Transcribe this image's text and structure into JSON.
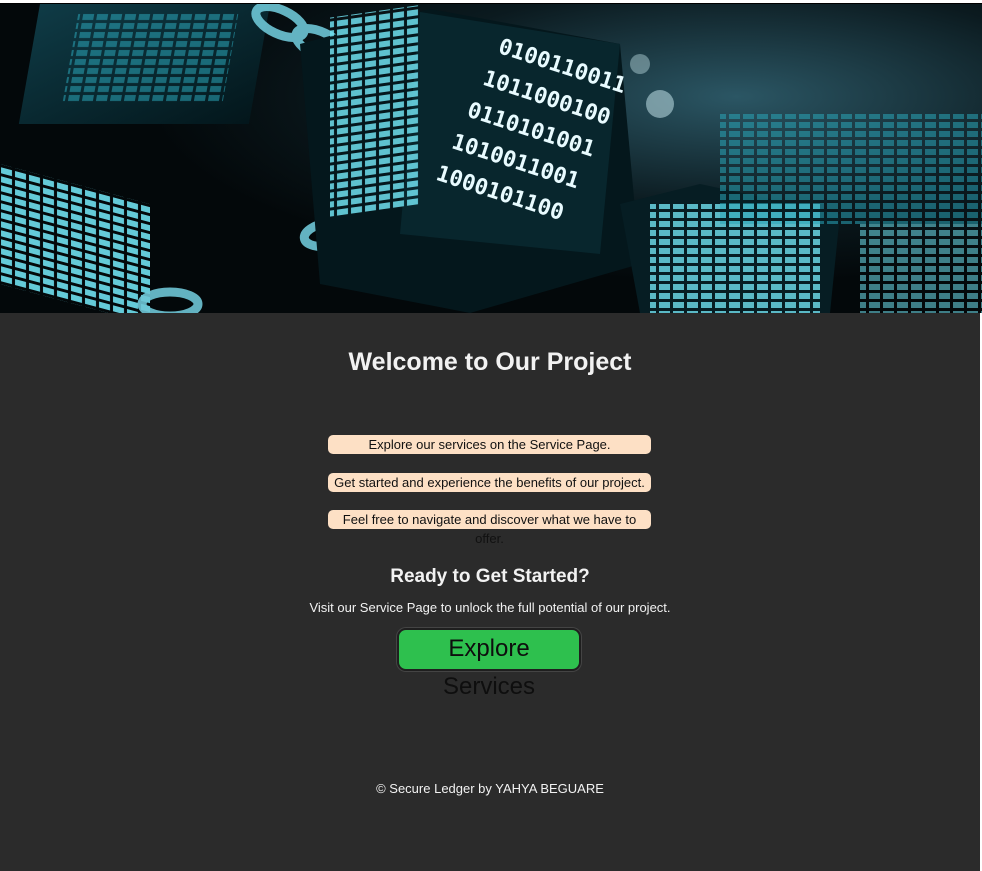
{
  "hero": {
    "image_description": "blockchain-cubes-chain-image",
    "binary_text": [
      "0100110011",
      "1011000100",
      "0110101001",
      "1010011001",
      "1000101100"
    ]
  },
  "main": {
    "title": "Welcome to Our Project",
    "highlights": [
      "Explore our services on the Service Page.",
      "Get started and experience the benefits of our project.",
      "Feel free to navigate and discover what we have to offer."
    ],
    "cta_heading": "Ready to Get Started?",
    "cta_text": "Visit our Service Page to unlock the full potential of our project.",
    "cta_button": "Explore Services"
  },
  "footer": {
    "text": "© Secure Ledger by YAHYA BEGUARE"
  },
  "colors": {
    "background": "#2b2b2b",
    "pill": "#fde0c5",
    "button": "#2ec04e",
    "text": "#f2f2f2"
  }
}
